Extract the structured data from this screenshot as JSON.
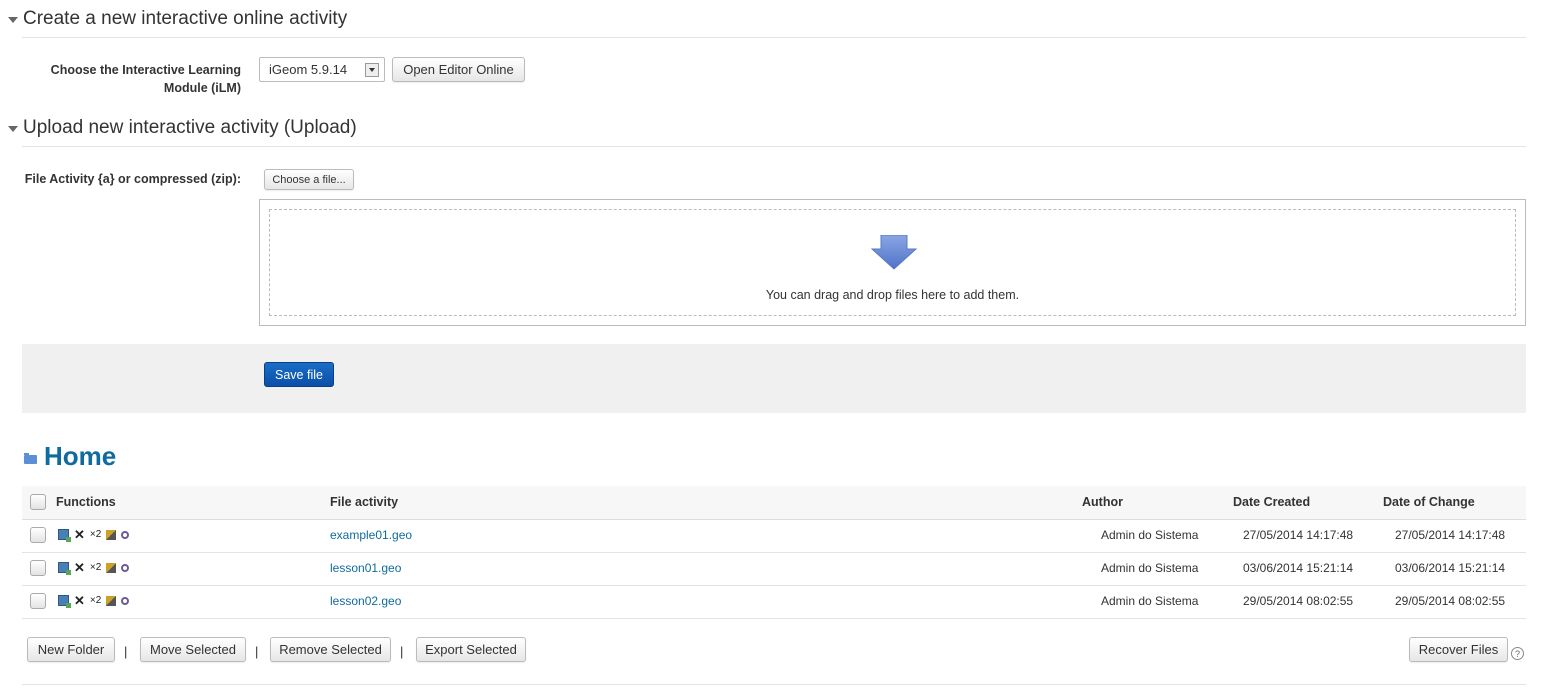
{
  "section_create": {
    "title": "Create a new interactive online activity",
    "ilm_label_line1": "Choose the Interactive Learning",
    "ilm_label_line2": "Module (iLM)",
    "ilm_selected": "iGeom 5.9.14",
    "open_editor_label": "Open Editor Online"
  },
  "section_upload": {
    "title": "Upload new interactive activity (Upload)",
    "file_label": "File Activity {a} or compressed (zip):",
    "choose_file_label": "Choose a file...",
    "drop_text": "You can drag and drop files here to add them.",
    "save_label": "Save file"
  },
  "home": {
    "title": "Home",
    "columns": [
      "Functions",
      "File activity",
      "Author",
      "Date Created",
      "Date of Change"
    ],
    "rows": [
      {
        "file": "example01.geo",
        "author": "Admin do Sistema",
        "created": "27/05/2014 14:17:48",
        "changed": "27/05/2014 14:17:48"
      },
      {
        "file": "lesson01.geo",
        "author": "Admin do Sistema",
        "created": "03/06/2014 15:21:14",
        "changed": "03/06/2014 15:21:14"
      },
      {
        "file": "lesson02.geo",
        "author": "Admin do Sistema",
        "created": "29/05/2014 08:02:55",
        "changed": "29/05/2014 08:02:55"
      }
    ],
    "func_copy_count": "×2",
    "actions": {
      "new_folder": "New Folder",
      "move_selected": "Move Selected",
      "remove_selected": "Remove Selected",
      "export_selected": "Export Selected",
      "recover_files": "Recover Files",
      "separator": "|",
      "help": "?"
    }
  },
  "colors": {
    "accent": "#0f6b9e",
    "primary_button": "#0a4fa8",
    "dropzone_arrow": "#6f8fd6"
  }
}
